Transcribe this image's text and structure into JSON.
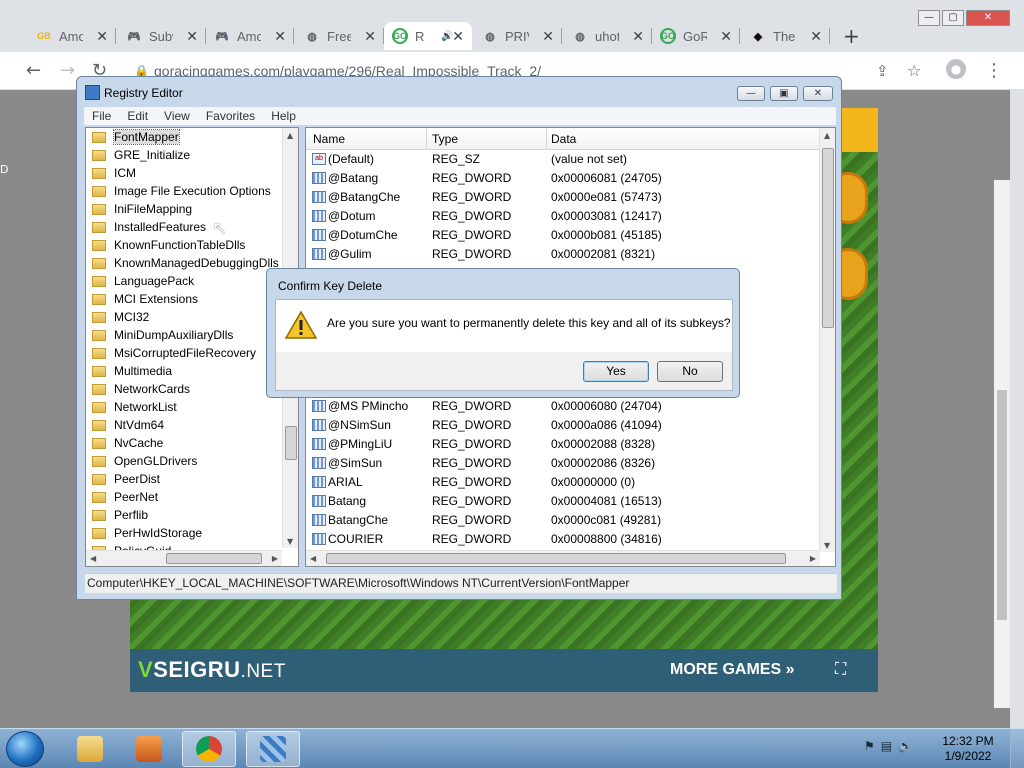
{
  "browser": {
    "tabs": [
      {
        "title": "Amo",
        "favicon": "GB",
        "color": "#f4b400"
      },
      {
        "title": "Subw",
        "favicon": "game-controller",
        "color": "#1e8e3e"
      },
      {
        "title": "Amo",
        "favicon": "game-controller",
        "color": "#1e8e3e"
      },
      {
        "title": "Free",
        "favicon": "globe",
        "color": "#5f6368"
      },
      {
        "title": "R",
        "favicon": "GO",
        "color": "#34a853",
        "active": true,
        "audio": true
      },
      {
        "title": "PRIV",
        "favicon": "globe",
        "color": "#5f6368"
      },
      {
        "title": "uhot",
        "favicon": "globe",
        "color": "#5f6368"
      },
      {
        "title": "GoR",
        "favicon": "GO",
        "color": "#34a853"
      },
      {
        "title": "The",
        "favicon": "shield",
        "color": "#111111"
      }
    ],
    "new_tab": "+",
    "url": "goracinggames.com/playgame/296/Real_Impossible_Track_2/",
    "window_controls": {
      "minimize": "—",
      "maximize": "▢",
      "close": "✕"
    }
  },
  "game": {
    "logo_v": "V",
    "logo_main": "SEIGRU",
    "logo_net": ".NET",
    "more_games": "MORE GAMES »",
    "fullscreen_icon": "⛶"
  },
  "regedit": {
    "title": "Registry Editor",
    "menu": [
      "File",
      "Edit",
      "View",
      "Favorites",
      "Help"
    ],
    "tree": [
      "FontMapper",
      "GRE_Initialize",
      "ICM",
      "Image File Execution Options",
      "IniFileMapping",
      "InstalledFeatures",
      "KnownFunctionTableDlls",
      "KnownManagedDebuggingDlls",
      "LanguagePack",
      "MCI Extensions",
      "MCI32",
      "MiniDumpAuxiliaryDlls",
      "MsiCorruptedFileRecovery",
      "Multimedia",
      "NetworkCards",
      "NetworkList",
      "NtVdm64",
      "NvCache",
      "OpenGLDrivers",
      "PeerDist",
      "PeerNet",
      "Perflib",
      "PerHwIdStorage",
      "PolicyGuid"
    ],
    "columns": {
      "name": "Name",
      "type": "Type",
      "data": "Data"
    },
    "rows_top": [
      {
        "name": "(Default)",
        "type": "REG_SZ",
        "data": "(value not set)",
        "kind": "sz"
      },
      {
        "name": "@Batang",
        "type": "REG_DWORD",
        "data": "0x00006081 (24705)",
        "kind": "dw"
      },
      {
        "name": "@BatangChe",
        "type": "REG_DWORD",
        "data": "0x0000e081 (57473)",
        "kind": "dw"
      },
      {
        "name": "@Dotum",
        "type": "REG_DWORD",
        "data": "0x00003081 (12417)",
        "kind": "dw"
      },
      {
        "name": "@DotumChe",
        "type": "REG_DWORD",
        "data": "0x0000b081 (45185)",
        "kind": "dw"
      },
      {
        "name": "@Gulim",
        "type": "REG_DWORD",
        "data": "0x00002081 (8321)",
        "kind": "dw"
      }
    ],
    "rows_bottom": [
      {
        "name": "@MS PMincho",
        "type": "REG_DWORD",
        "data": "0x00006080 (24704)",
        "kind": "dw"
      },
      {
        "name": "@NSimSun",
        "type": "REG_DWORD",
        "data": "0x0000a086 (41094)",
        "kind": "dw"
      },
      {
        "name": "@PMingLiU",
        "type": "REG_DWORD",
        "data": "0x00002088 (8328)",
        "kind": "dw"
      },
      {
        "name": "@SimSun",
        "type": "REG_DWORD",
        "data": "0x00002086 (8326)",
        "kind": "dw"
      },
      {
        "name": "ARIAL",
        "type": "REG_DWORD",
        "data": "0x00000000 (0)",
        "kind": "dw"
      },
      {
        "name": "Batang",
        "type": "REG_DWORD",
        "data": "0x00004081 (16513)",
        "kind": "dw"
      },
      {
        "name": "BatangChe",
        "type": "REG_DWORD",
        "data": "0x0000c081 (49281)",
        "kind": "dw"
      },
      {
        "name": "COURIER",
        "type": "REG_DWORD",
        "data": "0x00008800 (34816)",
        "kind": "dw"
      }
    ],
    "status": "Computer\\HKEY_LOCAL_MACHINE\\SOFTWARE\\Microsoft\\Windows NT\\CurrentVersion\\FontMapper"
  },
  "dialog": {
    "title": "Confirm Key Delete",
    "message": "Are you sure you want to permanently delete this key and all of its subkeys?",
    "yes": "Yes",
    "no": "No"
  },
  "taskbar": {
    "time": "12:32 PM",
    "date": "1/9/2022"
  }
}
